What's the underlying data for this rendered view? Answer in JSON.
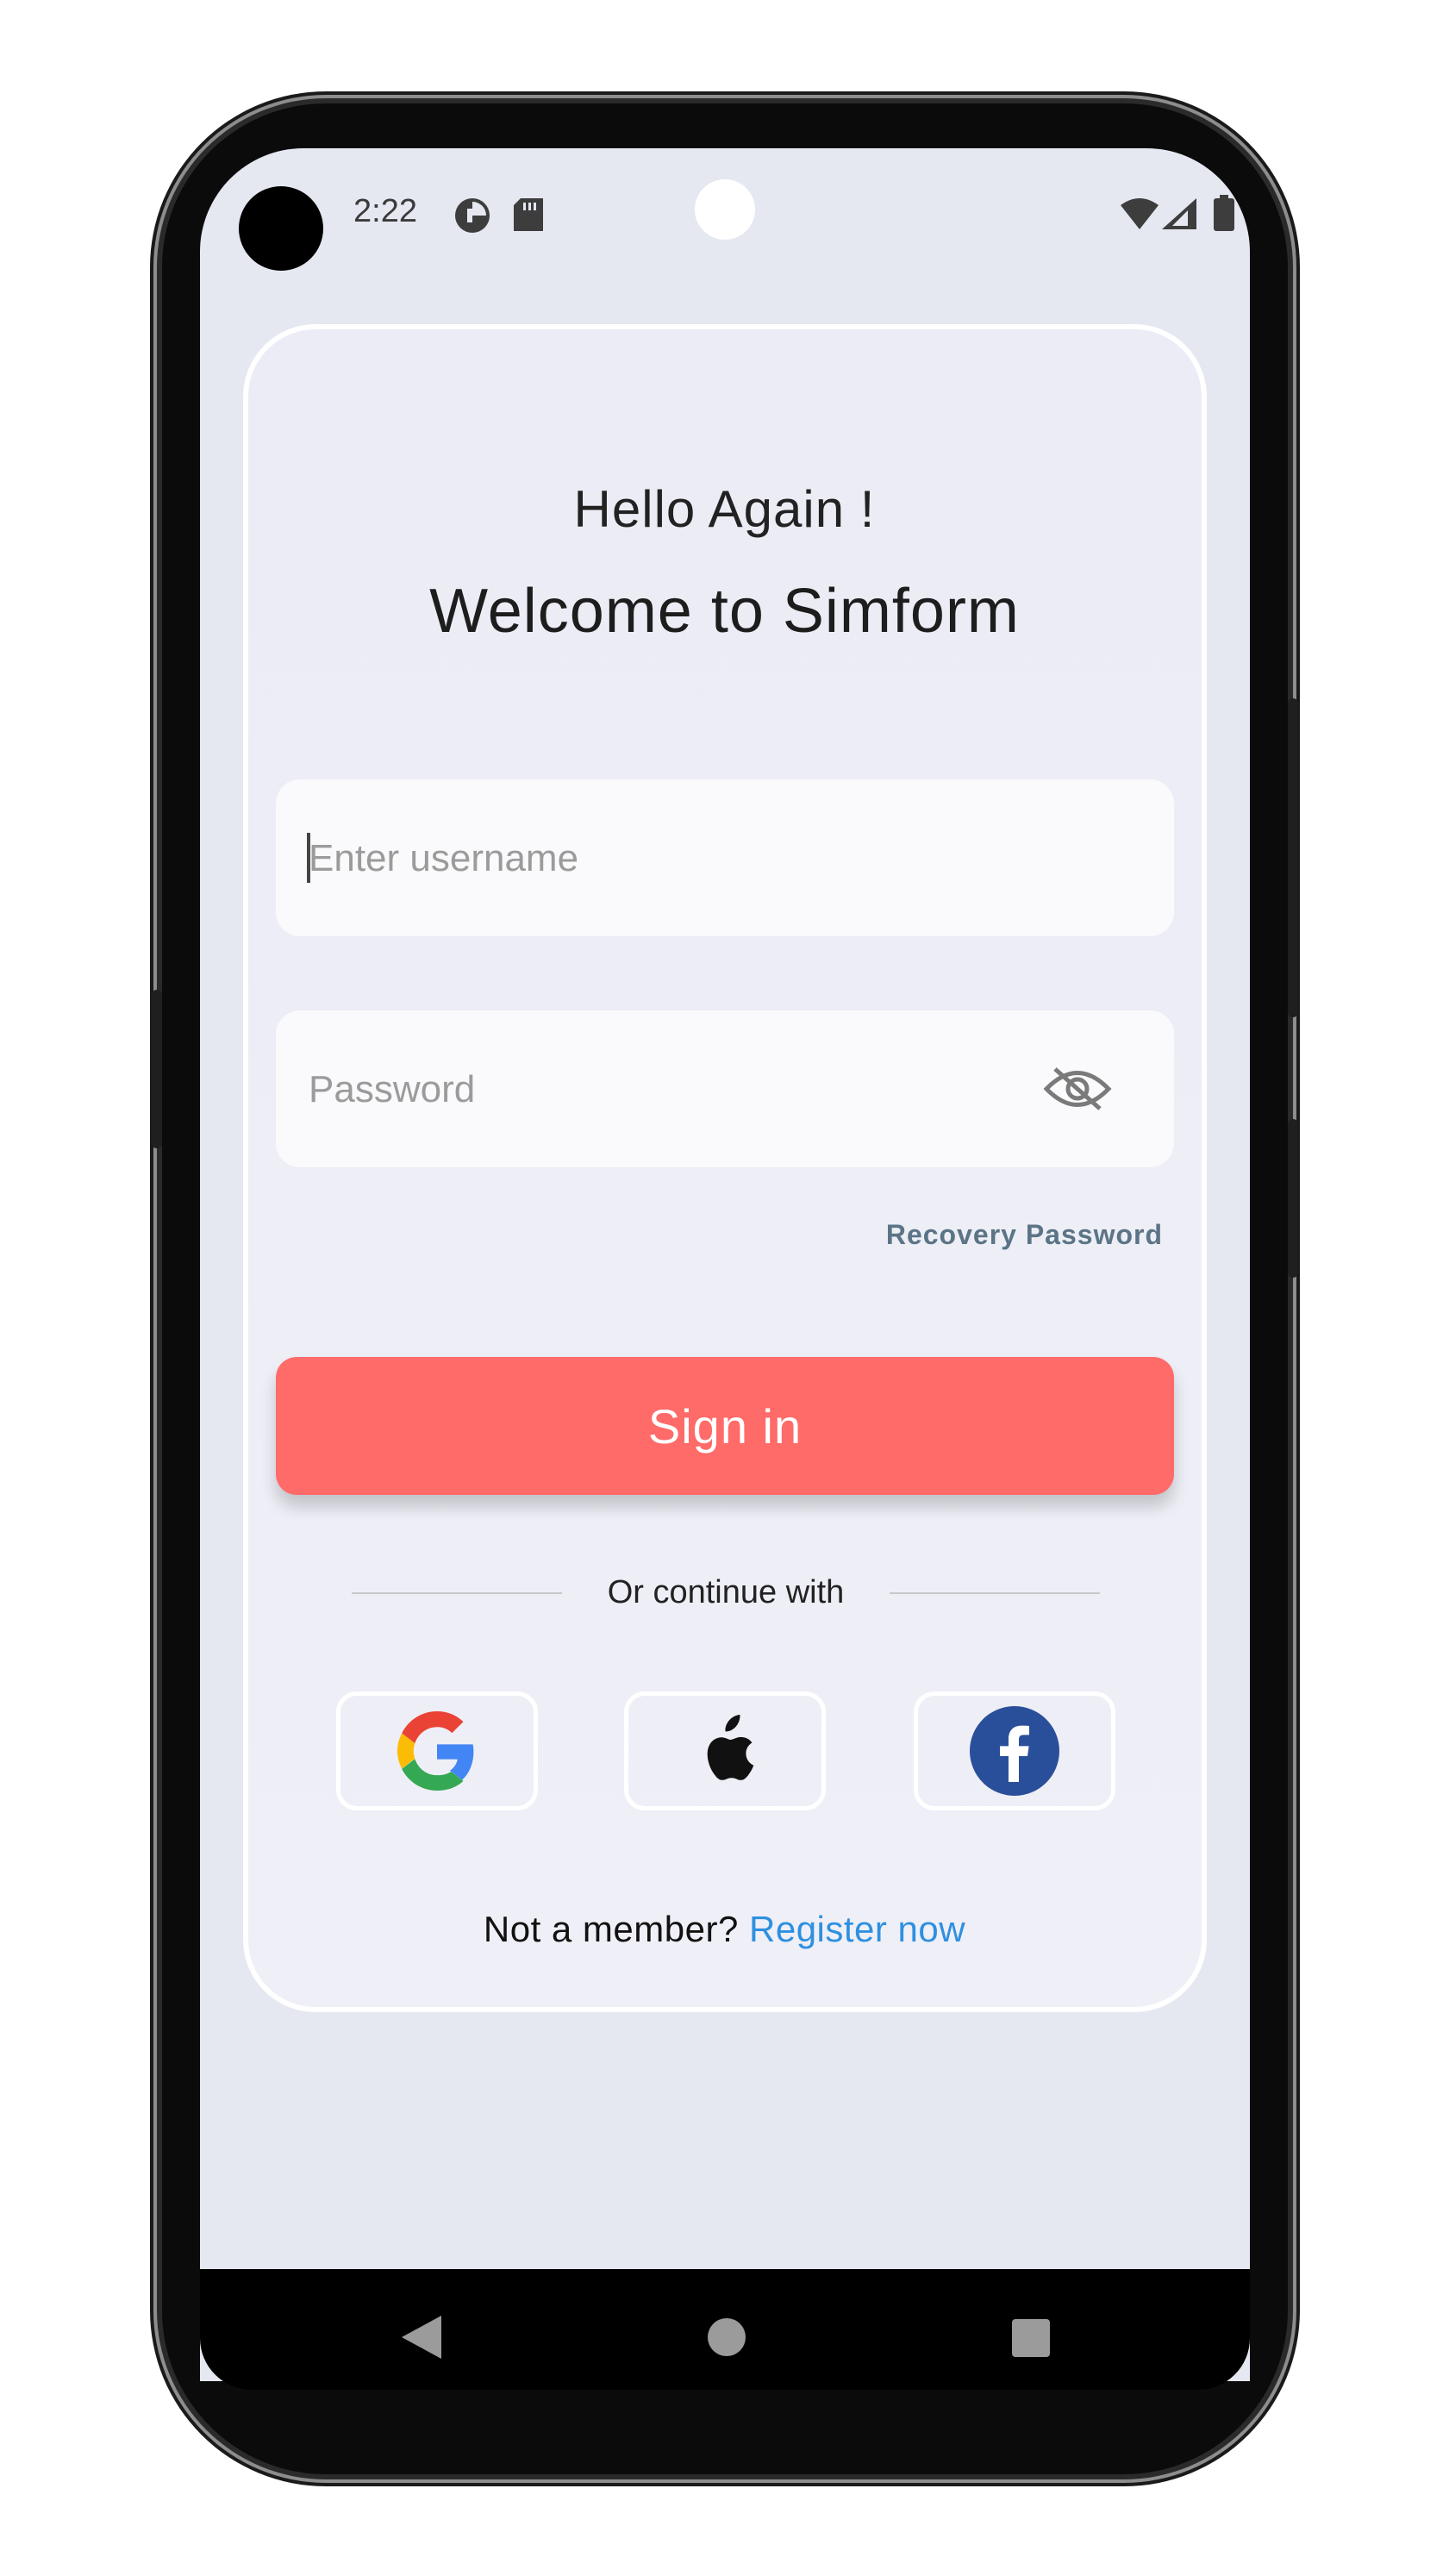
{
  "status_bar": {
    "time": "2:22",
    "icons": [
      "data-saver-icon",
      "sd-card-icon",
      "wifi-icon",
      "signal-icon",
      "battery-icon"
    ]
  },
  "header": {
    "greeting": "Hello Again !",
    "welcome": "Welcome to Simform"
  },
  "form": {
    "username_placeholder": "Enter username",
    "password_placeholder": "Password",
    "recovery_label": "Recovery Password",
    "signin_label": "Sign in"
  },
  "social": {
    "divider_text": "Or continue with",
    "providers": [
      "google-icon",
      "apple-icon",
      "facebook-icon"
    ]
  },
  "footer": {
    "prompt": "Not a member?",
    "register_label": "Register now"
  },
  "nav_bar": {
    "icons": [
      "back-icon",
      "home-icon",
      "recents-icon"
    ]
  },
  "colors": {
    "accent": "#fe6b69",
    "link": "#2e90e0",
    "recovery": "#5b7486",
    "screen_bg": "#e5e8f1",
    "facebook": "#2a4f9a"
  }
}
